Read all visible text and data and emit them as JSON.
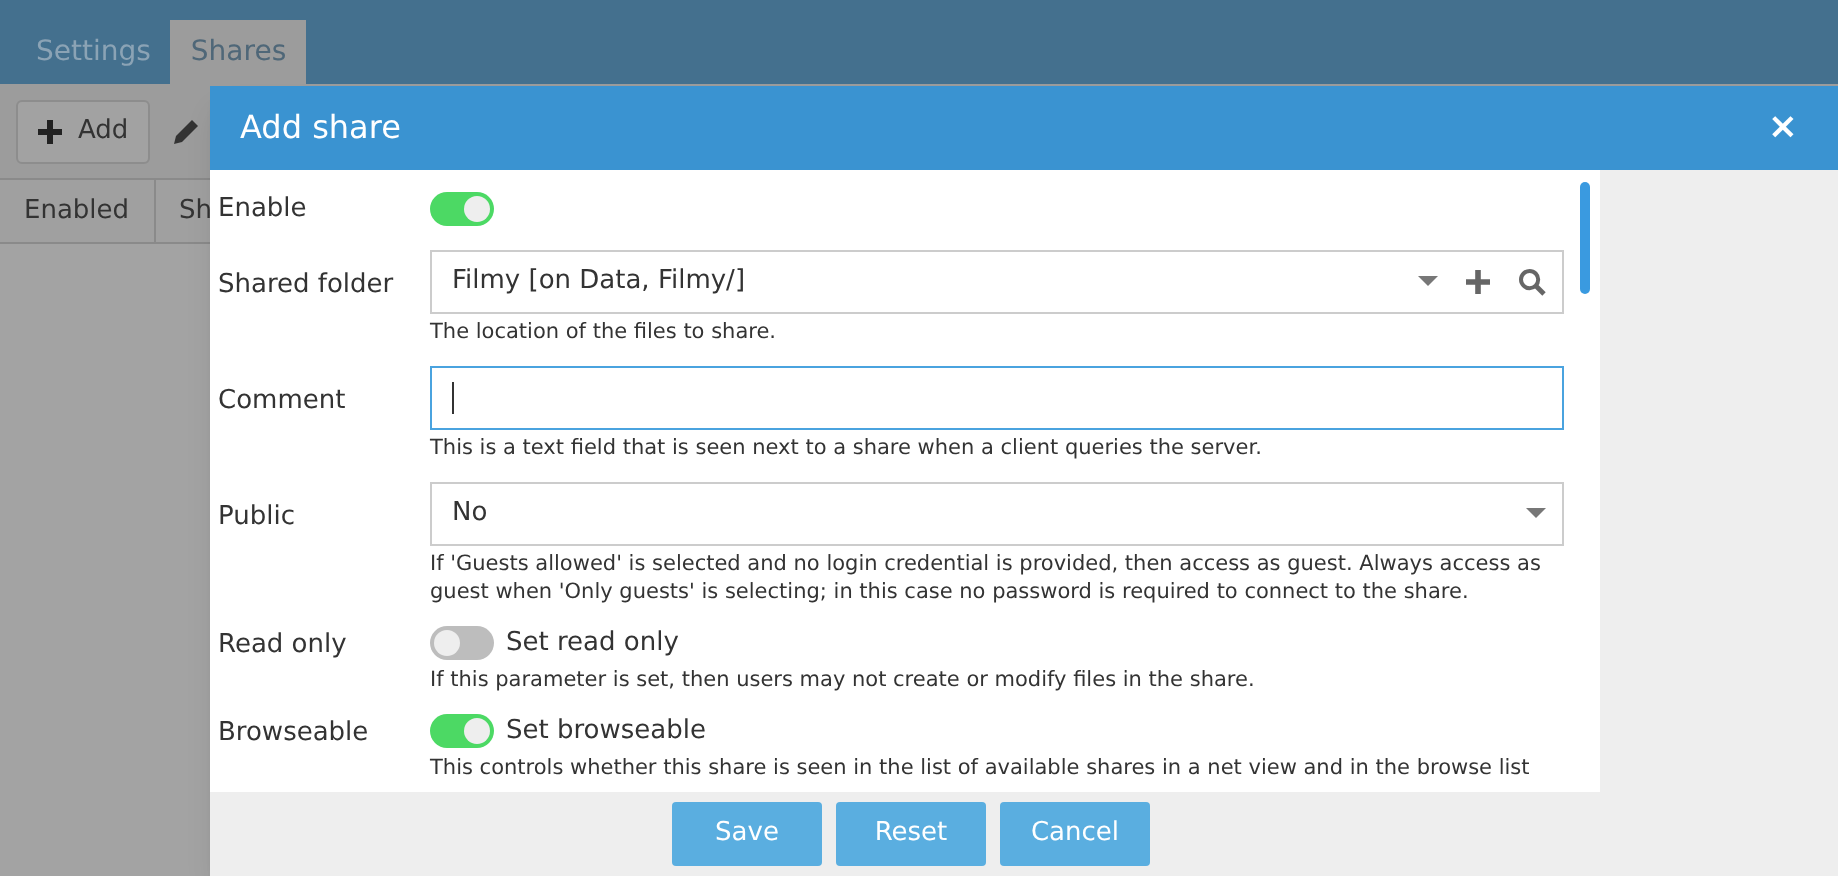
{
  "tabs": [
    {
      "label": "Settings",
      "selected": false
    },
    {
      "label": "Shares",
      "selected": true
    }
  ],
  "toolbar": {
    "add_button": "Add"
  },
  "table": {
    "columns": [
      "Enabled",
      "Sh"
    ]
  },
  "dialog": {
    "title": "Add share",
    "close": "×",
    "fields": [
      {
        "kind": "switch",
        "label": "Enable",
        "on": true
      },
      {
        "kind": "select",
        "label": "Shared folder",
        "value": "Filmy [on Data, Filmy/]",
        "help": "The location of the files to share.",
        "add": true,
        "search": true
      },
      {
        "kind": "text",
        "label": "Comment",
        "focused": true,
        "help": "This is a text field that is seen next to a share when a client queries the server."
      },
      {
        "kind": "select",
        "label": "Public",
        "value": "No",
        "help": "If 'Guests allowed' is selected and no login credential is provided, then access as guest. Always access as guest when 'Only guests' is selecting; in this case no password is required to connect to the share."
      },
      {
        "kind": "switch",
        "label": "Read only",
        "on": false,
        "caption": "Set read only",
        "help": "If this parameter is set, then users may not create or modify files in the share."
      },
      {
        "kind": "switch",
        "label": "Browseable",
        "on": true,
        "caption": "Set browseable",
        "help": "This controls whether this share is seen in the list of available shares in a net view and in the browse list"
      }
    ],
    "buttons": [
      "Save",
      "Reset",
      "Cancel"
    ]
  }
}
